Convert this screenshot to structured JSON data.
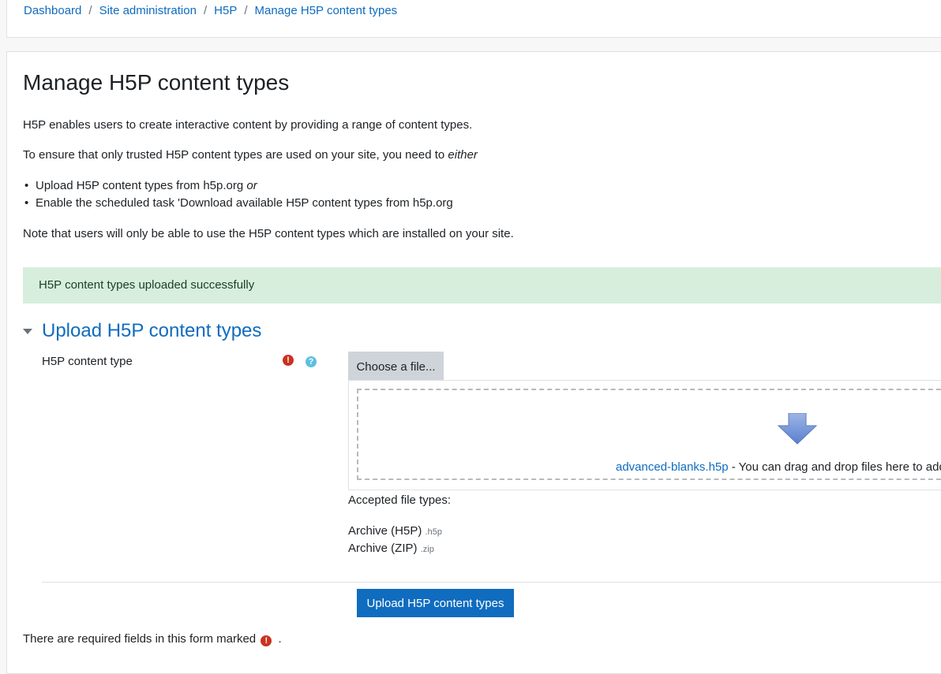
{
  "breadcrumb": [
    {
      "label": "Dashboard"
    },
    {
      "label": "Site administration"
    },
    {
      "label": "H5P"
    },
    {
      "label": "Manage H5P content types"
    }
  ],
  "breadcrumb_separator": "/",
  "page": {
    "title": "Manage H5P content types",
    "intro": "H5P enables users to create interactive content by providing a range of content types.",
    "ensure_text": "To ensure that only trusted H5P content types are used on your site, you need to ",
    "ensure_emph": "either",
    "bullets": [
      {
        "text": "Upload H5P content types from h5p.org ",
        "emph": "or"
      },
      {
        "text": "Enable the scheduled task 'Download available H5P content types from h5p.org",
        "emph": ""
      }
    ],
    "note": "Note that users will only be able to use the H5P content types which are installed on your site."
  },
  "alert": {
    "text": "H5P content types uploaded successfully",
    "color": "#d7eedd"
  },
  "upload_section": {
    "title": "Upload H5P content types",
    "field_label": "H5P content type",
    "choose_button": "Choose a file...",
    "file_link": "advanced-blanks.h5p",
    "drop_hint": " - You can drag and drop files here to add",
    "accepted_label": "Accepted file types:",
    "file_types": [
      {
        "name": "Archive (H5P)",
        "ext": ".h5p"
      },
      {
        "name": "Archive (ZIP)",
        "ext": ".zip"
      }
    ],
    "submit_button": "Upload H5P content types"
  },
  "required_note": {
    "text": "There are required fields in this form marked",
    "suffix": "."
  },
  "icons": {
    "required": "exclamation-circle",
    "help": "question-circle",
    "drop": "down-arrow"
  },
  "colors": {
    "link": "#0f6cbf",
    "primary": "#0f6cbf",
    "required": "#ca3120",
    "help": "#5bc0de"
  }
}
